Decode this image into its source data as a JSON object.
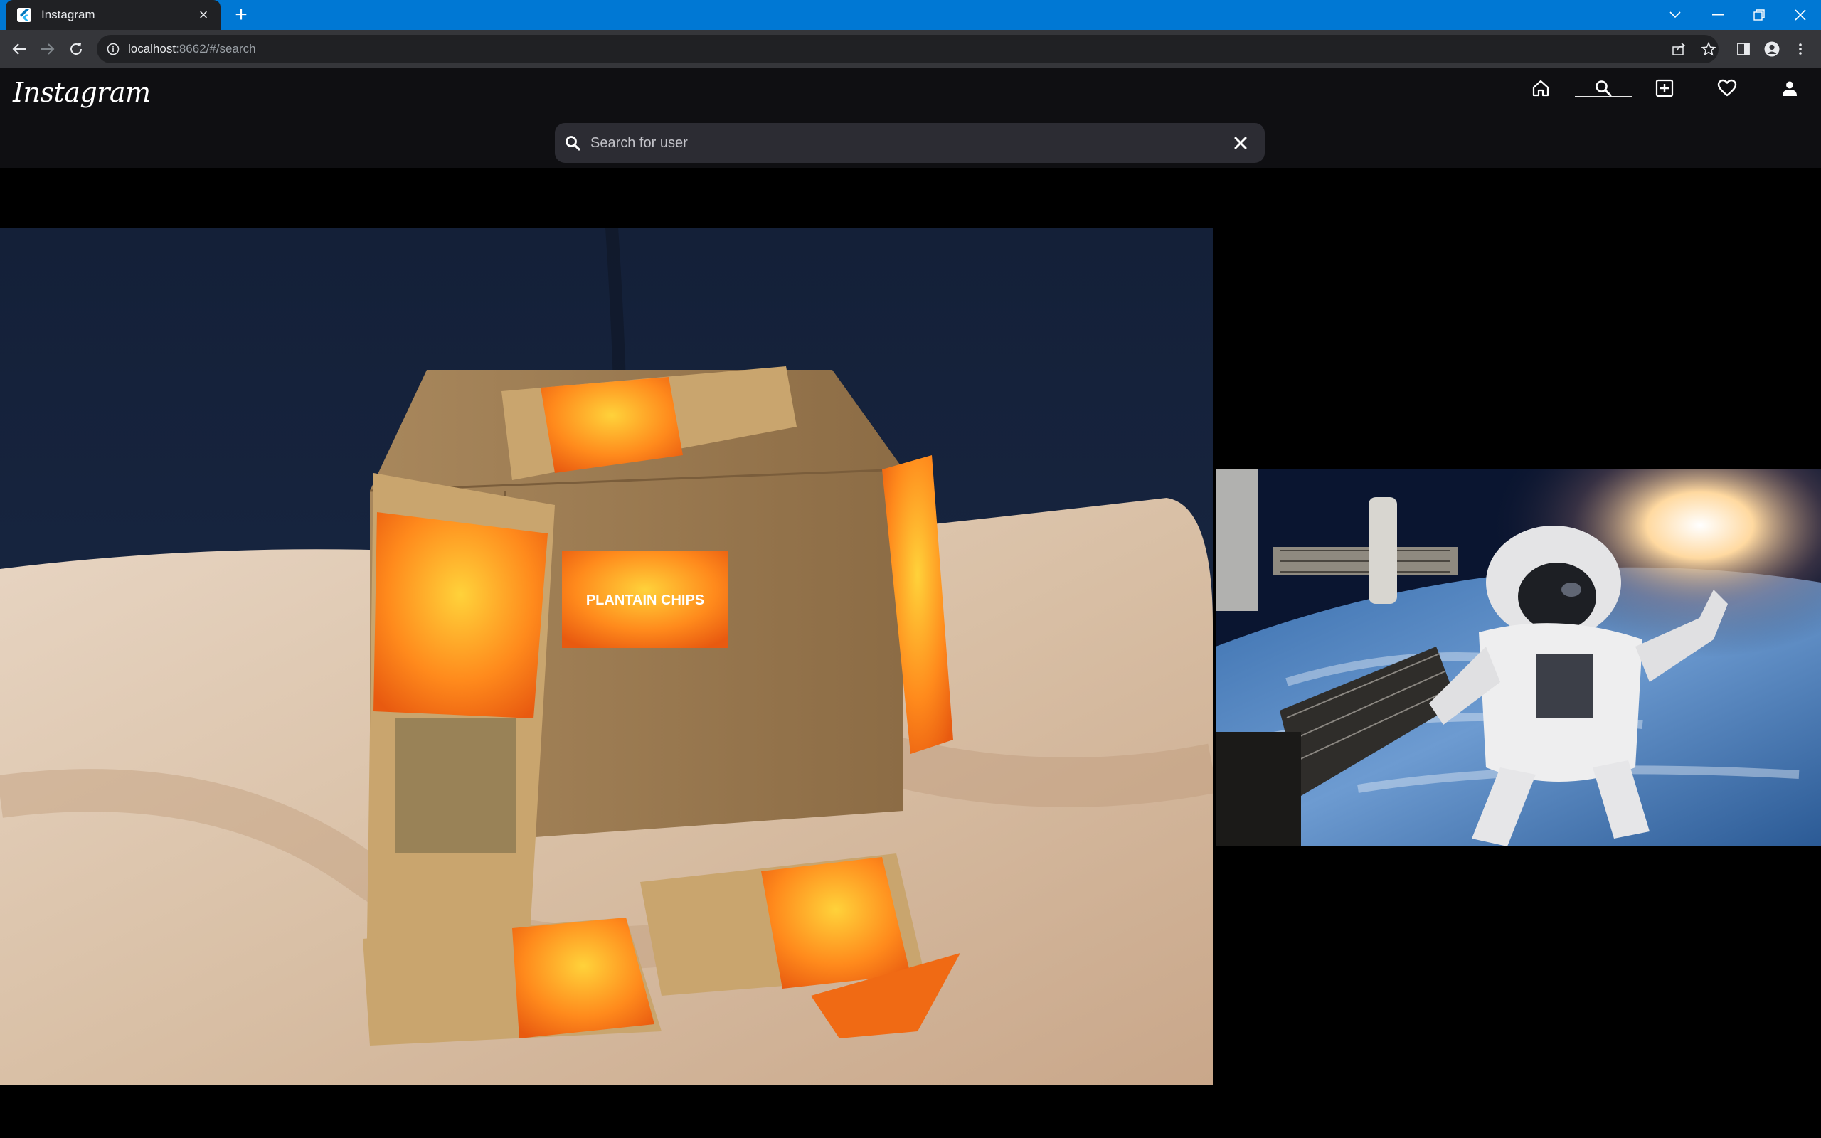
{
  "browser": {
    "tab_title": "Instagram",
    "url_host": "localhost",
    "url_rest": ":8662/#/search"
  },
  "app": {
    "logo": "Instagram",
    "nav": [
      "home-icon",
      "search-icon",
      "add-post-icon",
      "heart-icon",
      "profile-icon"
    ],
    "active_nav": "search-icon"
  },
  "search": {
    "placeholder": "Search for user",
    "value": ""
  },
  "results": [
    {
      "image": "plantain-chips-box-photo",
      "label": "PLANTAIN CHIPS"
    },
    {
      "image": "astronaut-space-photo"
    }
  ],
  "colors": {
    "tabstrip": "#0078d4",
    "toolbar": "#35363a",
    "header": "#0f0f12",
    "search_bg": "#2c2c33"
  }
}
